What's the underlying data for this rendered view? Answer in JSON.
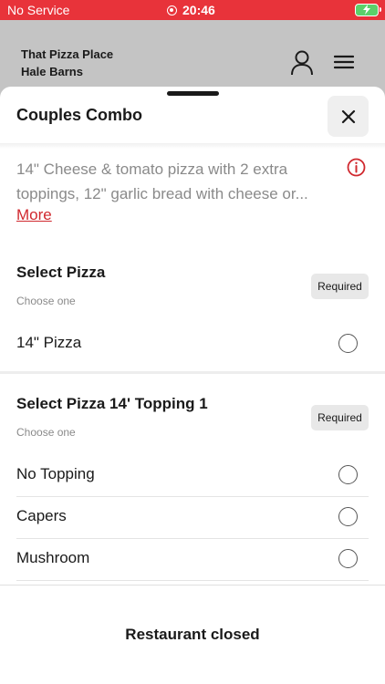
{
  "status_bar": {
    "carrier": "No Service",
    "time": "20:46"
  },
  "header": {
    "restaurant_line1": "That Pizza Place",
    "restaurant_line2": "Hale Barns"
  },
  "sheet": {
    "title": "Couples Combo",
    "description": "14\" Cheese & tomato pizza with 2 extra toppings, 12\" garlic bread with cheese or...",
    "more_label": "More"
  },
  "sections": [
    {
      "title": "Select Pizza",
      "subtitle": "Choose one",
      "badge": "Required",
      "options": [
        "14\" Pizza"
      ]
    },
    {
      "title": "Select Pizza 14' Topping 1",
      "subtitle": "Choose one",
      "badge": "Required",
      "options": [
        "No Topping",
        "Capers",
        "Mushroom"
      ]
    }
  ],
  "footer": {
    "status": "Restaurant closed"
  },
  "colors": {
    "accent": "#e8333a",
    "header_bg": "#c4c4c4",
    "link": "#d0282e"
  }
}
